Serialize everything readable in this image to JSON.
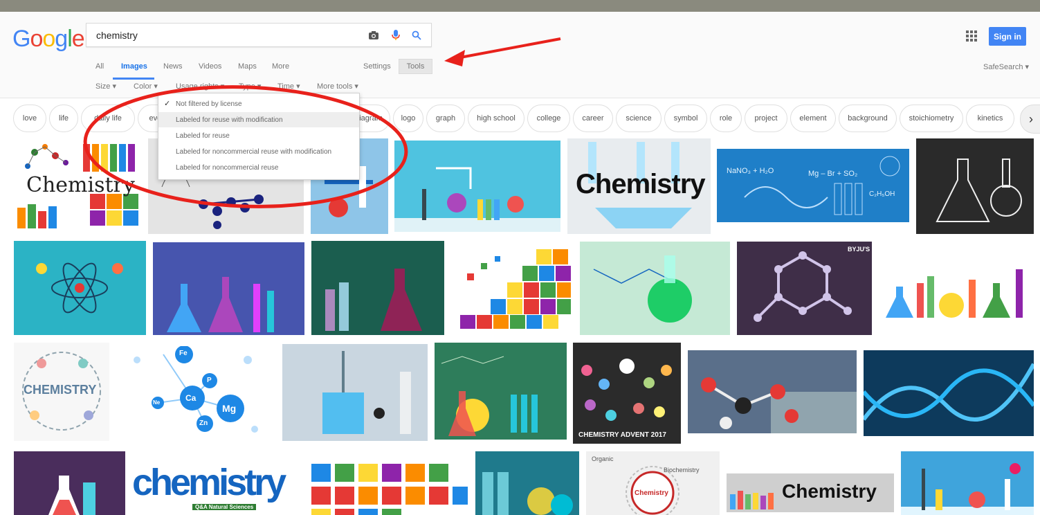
{
  "header": {
    "logo_letters": [
      {
        "ch": "G",
        "color": "#4285f4"
      },
      {
        "ch": "o",
        "color": "#ea4335"
      },
      {
        "ch": "o",
        "color": "#fbbc05"
      },
      {
        "ch": "g",
        "color": "#4285f4"
      },
      {
        "ch": "l",
        "color": "#34a853"
      },
      {
        "ch": "e",
        "color": "#ea4335"
      }
    ],
    "search_value": "chemistry",
    "signin_label": "Sign in",
    "icons": [
      "camera-icon",
      "microphone-icon",
      "search-icon",
      "apps-grid-icon"
    ]
  },
  "tabs": [
    "All",
    "Images",
    "News",
    "Videos",
    "Maps",
    "More"
  ],
  "active_tab": "Images",
  "settings_label": "Settings",
  "tools_label": "Tools",
  "safesearch_label": "SafeSearch ▾",
  "toolbar": [
    "Size ▾",
    "Color ▾",
    "Usage rights ▾",
    "Type ▾",
    "Time ▾",
    "More tools ▾"
  ],
  "usage_rights_menu": [
    "Not filtered by license",
    "Labeled for reuse with modification",
    "Labeled for reuse",
    "Labeled for noncommercial reuse with modification",
    "Labeled for noncommercial reuse"
  ],
  "usage_rights_selected": "Not filtered by license",
  "chips": [
    "love",
    "life",
    "daily life",
    "every",
    "diagram",
    "logo",
    "graph",
    "high school",
    "college",
    "career",
    "science",
    "symbol",
    "role",
    "project",
    "element",
    "background",
    "stoichiometry",
    "kinetics"
  ],
  "image_texts": {
    "chemistry_script": "Chemistry",
    "chemistry_bold": "Chemistry",
    "chemistry_advent": "CHEMISTRY ADVENT 2017",
    "chemistry_circle": "CHEMISTRY",
    "chemistry_blue": "chemistry",
    "q4_caption": "Q&A Natural Sciences",
    "organic_label": "Organic",
    "biochem_label": "Biochemistry",
    "chemistry_center": "Chemistry",
    "chemistry_strip": "Chemistry",
    "byjus": "BYJU'S",
    "formula_left": "NaNO₃ + H₂O",
    "formula_mid": "Mg – Br + SO₂",
    "formula_right": "C₂H₅OH",
    "element_mg": "Mg",
    "element_ca": "Ca",
    "element_zn": "Zn",
    "element_fe": "Fe",
    "element_p": "P",
    "element_ne": "Ne"
  },
  "colors": {
    "accent": "#4285f4",
    "annotation_red": "#e8211b"
  }
}
